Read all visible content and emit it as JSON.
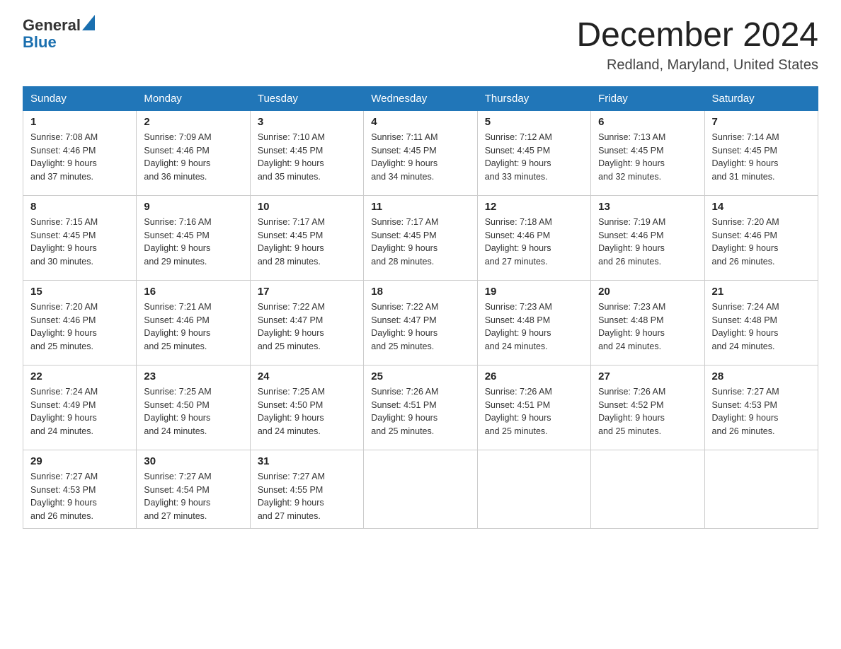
{
  "header": {
    "logo_general": "General",
    "logo_blue": "Blue",
    "title": "December 2024",
    "subtitle": "Redland, Maryland, United States"
  },
  "days_of_week": [
    "Sunday",
    "Monday",
    "Tuesday",
    "Wednesday",
    "Thursday",
    "Friday",
    "Saturday"
  ],
  "weeks": [
    [
      {
        "day": "1",
        "sunrise": "7:08 AM",
        "sunset": "4:46 PM",
        "daylight": "9 hours and 37 minutes."
      },
      {
        "day": "2",
        "sunrise": "7:09 AM",
        "sunset": "4:46 PM",
        "daylight": "9 hours and 36 minutes."
      },
      {
        "day": "3",
        "sunrise": "7:10 AM",
        "sunset": "4:45 PM",
        "daylight": "9 hours and 35 minutes."
      },
      {
        "day": "4",
        "sunrise": "7:11 AM",
        "sunset": "4:45 PM",
        "daylight": "9 hours and 34 minutes."
      },
      {
        "day": "5",
        "sunrise": "7:12 AM",
        "sunset": "4:45 PM",
        "daylight": "9 hours and 33 minutes."
      },
      {
        "day": "6",
        "sunrise": "7:13 AM",
        "sunset": "4:45 PM",
        "daylight": "9 hours and 32 minutes."
      },
      {
        "day": "7",
        "sunrise": "7:14 AM",
        "sunset": "4:45 PM",
        "daylight": "9 hours and 31 minutes."
      }
    ],
    [
      {
        "day": "8",
        "sunrise": "7:15 AM",
        "sunset": "4:45 PM",
        "daylight": "9 hours and 30 minutes."
      },
      {
        "day": "9",
        "sunrise": "7:16 AM",
        "sunset": "4:45 PM",
        "daylight": "9 hours and 29 minutes."
      },
      {
        "day": "10",
        "sunrise": "7:17 AM",
        "sunset": "4:45 PM",
        "daylight": "9 hours and 28 minutes."
      },
      {
        "day": "11",
        "sunrise": "7:17 AM",
        "sunset": "4:45 PM",
        "daylight": "9 hours and 28 minutes."
      },
      {
        "day": "12",
        "sunrise": "7:18 AM",
        "sunset": "4:46 PM",
        "daylight": "9 hours and 27 minutes."
      },
      {
        "day": "13",
        "sunrise": "7:19 AM",
        "sunset": "4:46 PM",
        "daylight": "9 hours and 26 minutes."
      },
      {
        "day": "14",
        "sunrise": "7:20 AM",
        "sunset": "4:46 PM",
        "daylight": "9 hours and 26 minutes."
      }
    ],
    [
      {
        "day": "15",
        "sunrise": "7:20 AM",
        "sunset": "4:46 PM",
        "daylight": "9 hours and 25 minutes."
      },
      {
        "day": "16",
        "sunrise": "7:21 AM",
        "sunset": "4:46 PM",
        "daylight": "9 hours and 25 minutes."
      },
      {
        "day": "17",
        "sunrise": "7:22 AM",
        "sunset": "4:47 PM",
        "daylight": "9 hours and 25 minutes."
      },
      {
        "day": "18",
        "sunrise": "7:22 AM",
        "sunset": "4:47 PM",
        "daylight": "9 hours and 25 minutes."
      },
      {
        "day": "19",
        "sunrise": "7:23 AM",
        "sunset": "4:48 PM",
        "daylight": "9 hours and 24 minutes."
      },
      {
        "day": "20",
        "sunrise": "7:23 AM",
        "sunset": "4:48 PM",
        "daylight": "9 hours and 24 minutes."
      },
      {
        "day": "21",
        "sunrise": "7:24 AM",
        "sunset": "4:48 PM",
        "daylight": "9 hours and 24 minutes."
      }
    ],
    [
      {
        "day": "22",
        "sunrise": "7:24 AM",
        "sunset": "4:49 PM",
        "daylight": "9 hours and 24 minutes."
      },
      {
        "day": "23",
        "sunrise": "7:25 AM",
        "sunset": "4:50 PM",
        "daylight": "9 hours and 24 minutes."
      },
      {
        "day": "24",
        "sunrise": "7:25 AM",
        "sunset": "4:50 PM",
        "daylight": "9 hours and 24 minutes."
      },
      {
        "day": "25",
        "sunrise": "7:26 AM",
        "sunset": "4:51 PM",
        "daylight": "9 hours and 25 minutes."
      },
      {
        "day": "26",
        "sunrise": "7:26 AM",
        "sunset": "4:51 PM",
        "daylight": "9 hours and 25 minutes."
      },
      {
        "day": "27",
        "sunrise": "7:26 AM",
        "sunset": "4:52 PM",
        "daylight": "9 hours and 25 minutes."
      },
      {
        "day": "28",
        "sunrise": "7:27 AM",
        "sunset": "4:53 PM",
        "daylight": "9 hours and 26 minutes."
      }
    ],
    [
      {
        "day": "29",
        "sunrise": "7:27 AM",
        "sunset": "4:53 PM",
        "daylight": "9 hours and 26 minutes."
      },
      {
        "day": "30",
        "sunrise": "7:27 AM",
        "sunset": "4:54 PM",
        "daylight": "9 hours and 27 minutes."
      },
      {
        "day": "31",
        "sunrise": "7:27 AM",
        "sunset": "4:55 PM",
        "daylight": "9 hours and 27 minutes."
      },
      null,
      null,
      null,
      null
    ]
  ],
  "labels": {
    "sunrise": "Sunrise:",
    "sunset": "Sunset:",
    "daylight": "Daylight:"
  }
}
